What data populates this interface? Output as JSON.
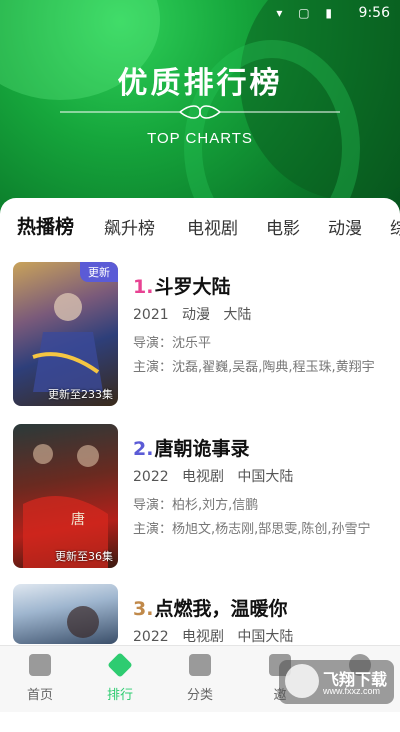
{
  "status": {
    "time": "9:56"
  },
  "hero": {
    "title": "优质排行榜",
    "subtitle": "TOP CHARTS"
  },
  "tabs": [
    {
      "label": "热播榜",
      "active": true
    },
    {
      "label": "飙升榜"
    },
    {
      "label": "电视剧"
    },
    {
      "label": "电影"
    },
    {
      "label": "动漫"
    },
    {
      "label": "综"
    }
  ],
  "items": [
    {
      "rank": "1.",
      "title": "斗罗大陆",
      "rank_color": "#e84393",
      "badge": "更新",
      "episode": "更新至233集",
      "year": "2021",
      "type": "动漫",
      "region": "大陆",
      "director": "导演：沈乐平",
      "cast": "主演：沈磊,翟巍,吴磊,陶典,程玉珠,黄翔宇"
    },
    {
      "rank": "2.",
      "title": "唐朝诡事录",
      "rank_color": "#5b5bd6",
      "episode": "更新至36集",
      "year": "2022",
      "type": "电视剧",
      "region": "中国大陆",
      "director": "导演：柏杉,刘方,信鹏",
      "cast": "主演：杨旭文,杨志刚,郜思雯,陈创,孙雪宁"
    },
    {
      "rank": "3.",
      "title": "点燃我，温暖你",
      "rank_color": "#c0894a",
      "year": "2022",
      "type": "电视剧",
      "region": "中国大陆"
    }
  ],
  "nav": [
    {
      "label": "首页",
      "icon": "home-icon"
    },
    {
      "label": "排行",
      "icon": "rank-icon",
      "active": true
    },
    {
      "label": "分类",
      "icon": "folder-icon"
    },
    {
      "label": "邀",
      "icon": "share-icon"
    },
    {
      "label": "",
      "icon": "user-icon"
    }
  ],
  "watermark": {
    "text": "飞翔下载",
    "url": "www.fxxz.com"
  }
}
